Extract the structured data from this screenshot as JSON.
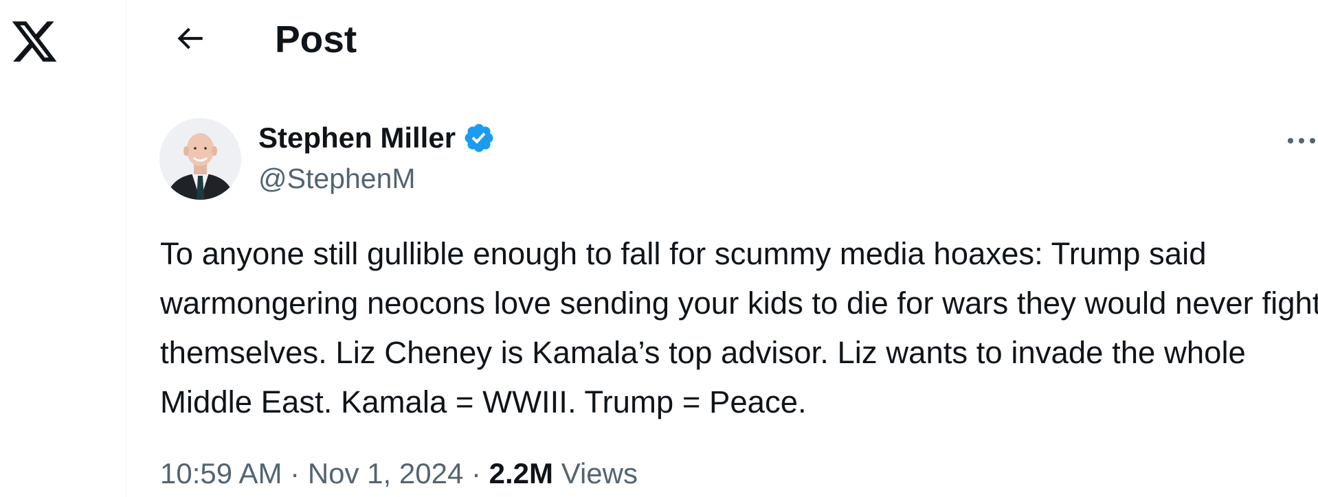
{
  "colors": {
    "text_primary": "#0f1419",
    "text_secondary": "#536471",
    "verified_blue": "#1d9bf0",
    "divider": "#eff3f4"
  },
  "icons": {
    "logo": "x-logo-icon",
    "back": "arrow-left-icon",
    "verified": "verified-badge-icon",
    "more": "more-horizontal-icon"
  },
  "header": {
    "title": "Post"
  },
  "post": {
    "author": {
      "name": "Stephen Miller",
      "handle": "@StephenM",
      "verified": true
    },
    "text": "To anyone still gullible enough to fall for scummy media hoaxes: Trump said warmongering neocons love sending your kids to die for wars they would never fight themselves. Liz Cheney is Kamala’s top advisor. Liz wants to invade the whole Middle East. Kamala = WWIII. Trump = Peace.",
    "time": "10:59 AM",
    "date": "Nov 1, 2024",
    "separator": "·",
    "views_count": "2.2M",
    "views_label": "Views"
  }
}
